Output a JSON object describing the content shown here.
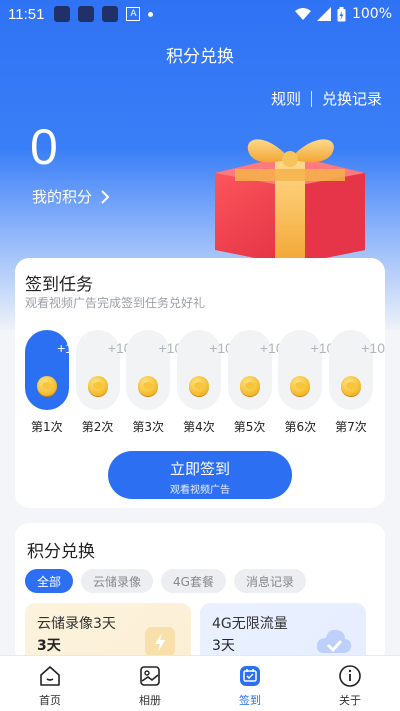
{
  "status_bar": {
    "time": "11:51",
    "battery": "100%"
  },
  "header": {
    "title": "积分兑换",
    "rules_link": "规则",
    "history_link": "兑换记录"
  },
  "points": {
    "value": "0",
    "label": "我的积分"
  },
  "checkin": {
    "title": "签到任务",
    "subtitle": "观看视频广告完成签到任务兑好礼",
    "days": [
      {
        "reward": "+10",
        "label": "第1次",
        "active": true
      },
      {
        "reward": "+10",
        "label": "第2次",
        "active": false
      },
      {
        "reward": "+10",
        "label": "第3次",
        "active": false
      },
      {
        "reward": "+10",
        "label": "第4次",
        "active": false
      },
      {
        "reward": "+10",
        "label": "第5次",
        "active": false
      },
      {
        "reward": "+10",
        "label": "第6次",
        "active": false
      },
      {
        "reward": "+10",
        "label": "第7次",
        "active": false
      }
    ],
    "button_label": "立即签到",
    "button_sub": "观看视频广告"
  },
  "exchange": {
    "title": "积分兑换",
    "tabs": [
      "全部",
      "云储录像",
      "4G套餐",
      "消息记录"
    ],
    "items": [
      {
        "name": "云储录像3天",
        "duration": "3天"
      },
      {
        "name": "4G无限流量",
        "duration": "3天"
      }
    ]
  },
  "nav": {
    "items": [
      {
        "label": "首页",
        "icon": "home-icon"
      },
      {
        "label": "相册",
        "icon": "album-icon"
      },
      {
        "label": "签到",
        "icon": "checkin-icon"
      },
      {
        "label": "关于",
        "icon": "info-icon"
      }
    ]
  },
  "colors": {
    "accent": "#2d6ff3",
    "hero_top": "#2f73f5"
  }
}
